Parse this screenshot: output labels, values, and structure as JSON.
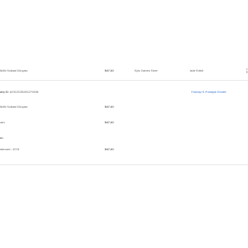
{
  "purchase": {
    "item_name": "MAN Suikast Dünyası",
    "price": "₺67,60",
    "store": "Epic Games Store",
    "status": "İade Edildi"
  },
  "details": {
    "order_id_label": "ariş ID:",
    "order_id_value": "A23122281051273498",
    "email_invoice_link": "Faturayı E-Postayla Gönder",
    "item_name": "MAN Suikast Dünyası",
    "item_price": "₺67,60",
    "tax_label": "ıam",
    "tax_value": "₺67,60",
    "payment_heading": "en",
    "payment_method": "stercard - 0278",
    "payment_amount": "₺67,60"
  },
  "icons": {
    "more": "more-options-icon"
  }
}
